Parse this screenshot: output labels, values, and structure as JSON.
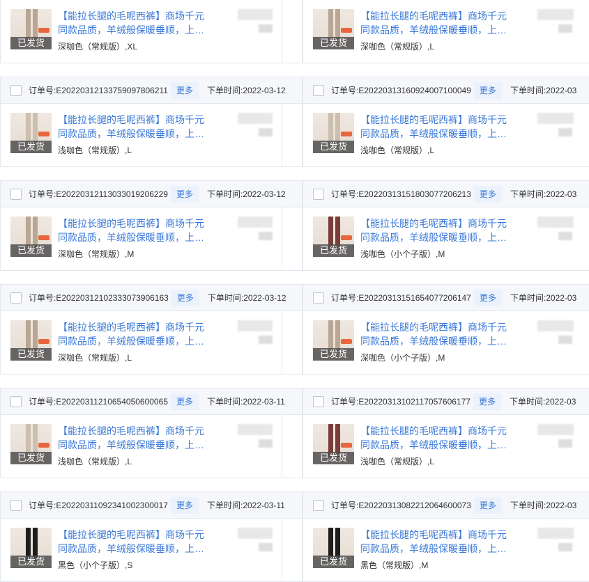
{
  "labels": {
    "order_no": "订单号:",
    "more": "更多",
    "order_time": "下单时间:",
    "shipped": "已发货",
    "title_line1": "【能拉长腿的毛呢西裤】商场千元",
    "title_line2": "同款品质，羊绒般保暖垂顺，上…"
  },
  "left": [
    {
      "order_no": "",
      "time": "",
      "sku": "深咖色（常规版）,XL"
    },
    {
      "order_no": "E20220312133759097806211",
      "time": "2022-03-12",
      "sku": "浅咖色（常规版）,L"
    },
    {
      "order_no": "E20220312113033019206229",
      "time": "2022-03-12",
      "sku": "深咖色（常规版）,M"
    },
    {
      "order_no": "E20220312102333073906163",
      "time": "2022-03-12",
      "sku": "深咖色（常规版）,L"
    },
    {
      "order_no": "E20220311210654050600065",
      "time": "2022-03-11",
      "sku": "浅咖色（常规版）,L"
    },
    {
      "order_no": "E20220311092341002300017",
      "time": "2022-03-11",
      "sku": "黑色（小个子版）,S"
    }
  ],
  "right": [
    {
      "order_no": "",
      "time": "",
      "sku": "深咖色（常规版）,L"
    },
    {
      "order_no": "E20220313160924007100049",
      "time": "2022-03",
      "sku": "浅咖色（常规版）,L"
    },
    {
      "order_no": "E20220313151803077206213",
      "time": "2022-03",
      "sku": "浅咖色（小个子版）,M"
    },
    {
      "order_no": "E20220313151654077206147",
      "time": "2022-03",
      "sku": "深咖色（小个子版）,M"
    },
    {
      "order_no": "E20220313102117057606177",
      "time": "2022-03",
      "sku": "浅咖色（常规版）,L"
    },
    {
      "order_no": "E20220313082212064600073",
      "time": "2022-03",
      "sku": "黑色（常规版）,M"
    }
  ],
  "colors": {
    "link": "#3a78d8",
    "header_bg": "#f5f7fa",
    "border": "#e4e7ed",
    "more_bg": "#ecf2fc",
    "shipped_bg": "#505050"
  }
}
